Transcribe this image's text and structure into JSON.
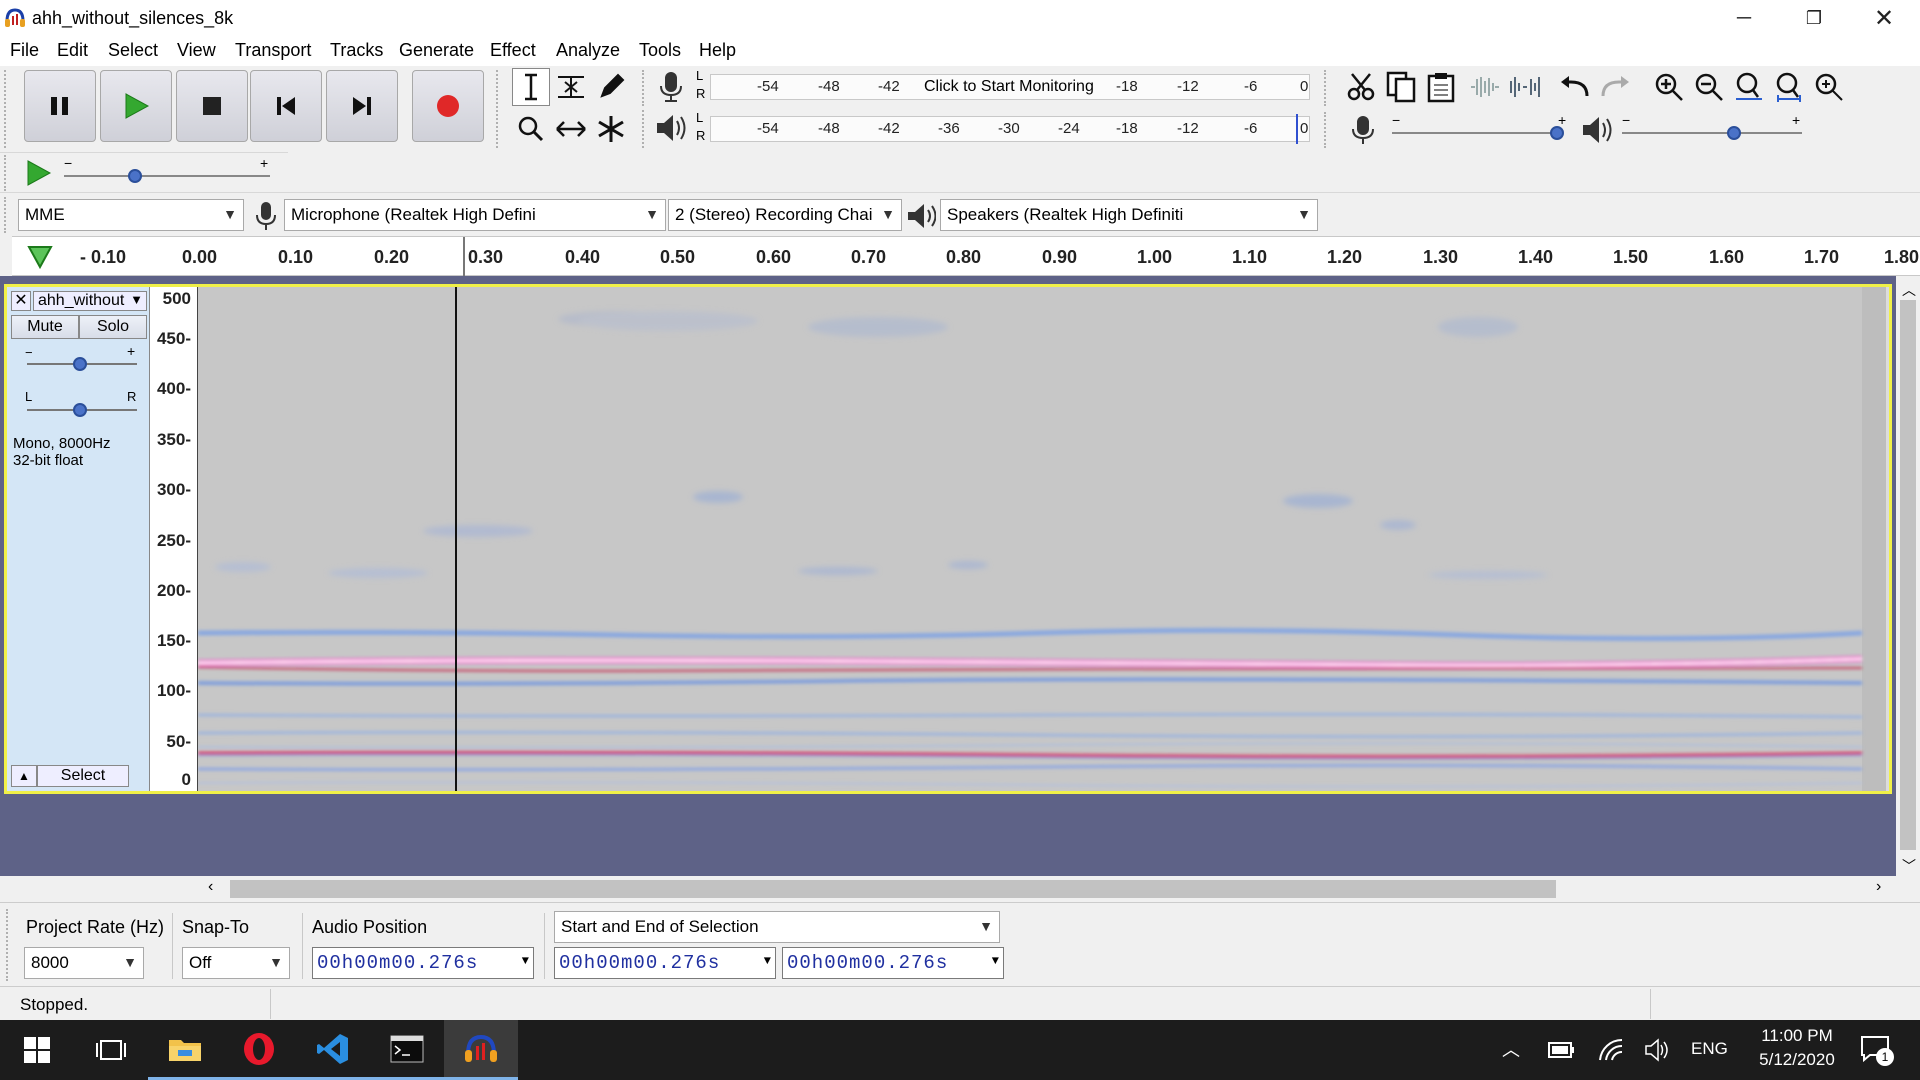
{
  "window": {
    "title": "ahh_without_silences_8k",
    "minimize_icon": "minimize-icon",
    "restore_icon": "restore-icon",
    "close_icon": "close-icon"
  },
  "menu": [
    "File",
    "Edit",
    "Select",
    "View",
    "Transport",
    "Tracks",
    "Generate",
    "Effect",
    "Analyze",
    "Tools",
    "Help"
  ],
  "meters": {
    "record_scale": [
      "-54",
      "-48",
      "-42",
      "Click to Start Monitoring",
      "-18",
      "-12",
      "-6",
      "0"
    ],
    "play_scale": [
      "-54",
      "-48",
      "-42",
      "-36",
      "-30",
      "-24",
      "-18",
      "-12",
      "-6",
      "0"
    ],
    "lr_top": [
      "L",
      "R"
    ],
    "lr_bottom": [
      "L",
      "R"
    ]
  },
  "device": {
    "host": "MME",
    "input": "Microphone (Realtek High Defini",
    "channels": "2 (Stereo) Recording Chai",
    "output": "Speakers (Realtek High Definiti"
  },
  "ruler": [
    "- 0.10",
    "0.00",
    "0.10",
    "0.20",
    "0.30",
    "0.40",
    "0.50",
    "0.60",
    "0.70",
    "0.80",
    "0.90",
    "1.00",
    "1.10",
    "1.20",
    "1.30",
    "1.40",
    "1.50",
    "1.60",
    "1.70",
    "1.80"
  ],
  "track": {
    "name": "ahh_without",
    "mute": "Mute",
    "solo": "Solo",
    "gain_minus": "−",
    "gain_plus": "+",
    "pan_left": "L",
    "pan_right": "R",
    "info_line1": "Mono, 8000Hz",
    "info_line2": "32-bit float",
    "select": "Select",
    "vscale": [
      "500",
      "450-",
      "400-",
      "350-",
      "300-",
      "250-",
      "200-",
      "150-",
      "100-",
      "50-",
      "0"
    ]
  },
  "selection_toolbar": {
    "project_rate_label": "Project Rate (Hz)",
    "project_rate": "8000",
    "snap_to_label": "Snap-To",
    "snap_to": "Off",
    "audio_position_label": "Audio Position",
    "audio_position": "00h00m00.276s",
    "selection_mode": "Start and End of Selection",
    "sel_start": "00h00m00.276s",
    "sel_end": "00h00m00.276s"
  },
  "status": "Stopped.",
  "taskbar": {
    "lang": "ENG",
    "time": "11:00 PM",
    "date": "5/12/2020",
    "notifications": "1"
  }
}
